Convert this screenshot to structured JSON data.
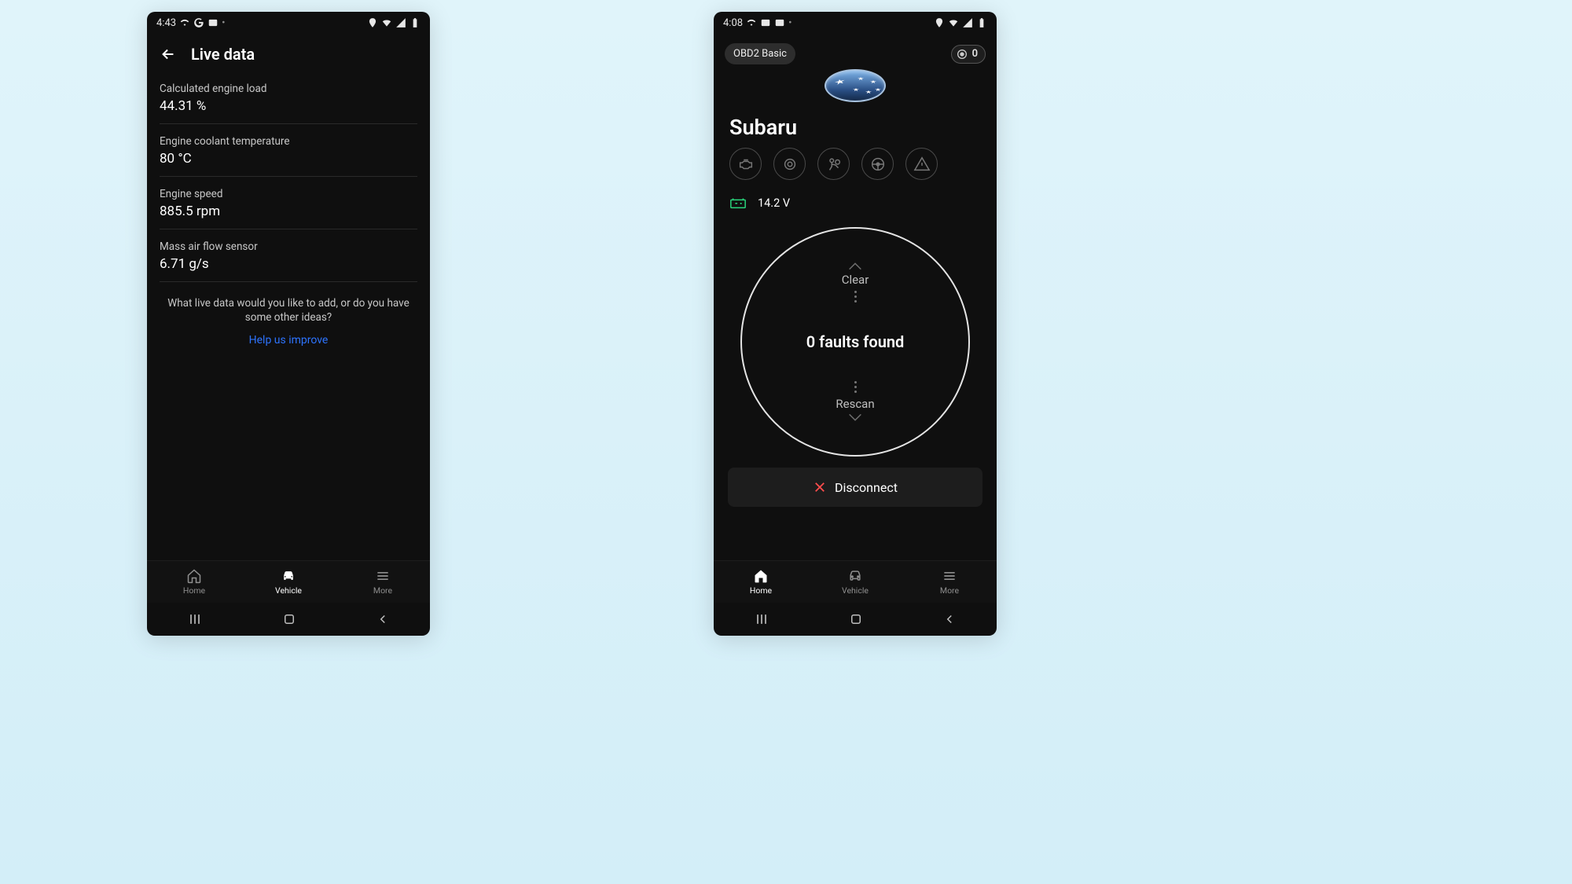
{
  "left": {
    "status": {
      "time": "4:43"
    },
    "title": "Live data",
    "rows": [
      {
        "label": "Calculated engine load",
        "value": "44.31 %"
      },
      {
        "label": "Engine coolant temperature",
        "value": "80 °C"
      },
      {
        "label": "Engine speed",
        "value": "885.5 rpm"
      },
      {
        "label": "Mass air flow sensor",
        "value": "6.71 g/s"
      }
    ],
    "prompt": "What live data would you like to add, or do you have some other ideas?",
    "help_link": "Help us improve",
    "nav": {
      "home": "Home",
      "vehicle": "Vehicle",
      "more": "More"
    }
  },
  "right": {
    "status": {
      "time": "4:08"
    },
    "chip": "OBD2 Basic",
    "fault_badge": "0",
    "brand": "Subaru",
    "voltage": "14.2 V",
    "scan": {
      "clear": "Clear",
      "result": "0 faults found",
      "rescan": "Rescan"
    },
    "disconnect": "Disconnect",
    "nav": {
      "home": "Home",
      "vehicle": "Vehicle",
      "more": "More"
    }
  }
}
